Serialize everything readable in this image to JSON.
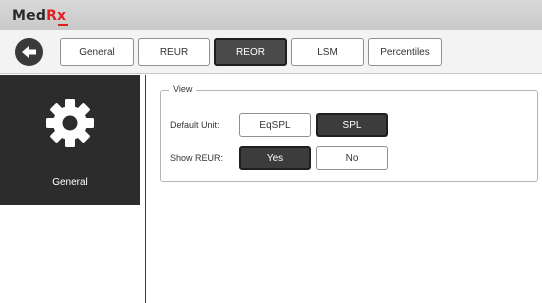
{
  "app": {
    "logo_main": "Med",
    "logo_accent": "Rx",
    "brand_accent_color": "#e02020"
  },
  "toolbar": {
    "back_icon": "arrow-left-icon",
    "tabs": [
      {
        "label": "General",
        "active": false
      },
      {
        "label": "REUR",
        "active": false
      },
      {
        "label": "REOR",
        "active": true
      },
      {
        "label": "LSM",
        "active": false
      },
      {
        "label": "Percentiles",
        "active": false
      }
    ]
  },
  "sidebar": {
    "item_label": "General",
    "item_icon": "gear-icon"
  },
  "view_group": {
    "title": "View",
    "default_unit": {
      "label": "Default Unit:",
      "options": [
        "EqSPL",
        "SPL"
      ],
      "selected": "SPL"
    },
    "show_reur": {
      "label": "Show REUR:",
      "options": [
        "Yes",
        "No"
      ],
      "selected": "Yes"
    }
  }
}
